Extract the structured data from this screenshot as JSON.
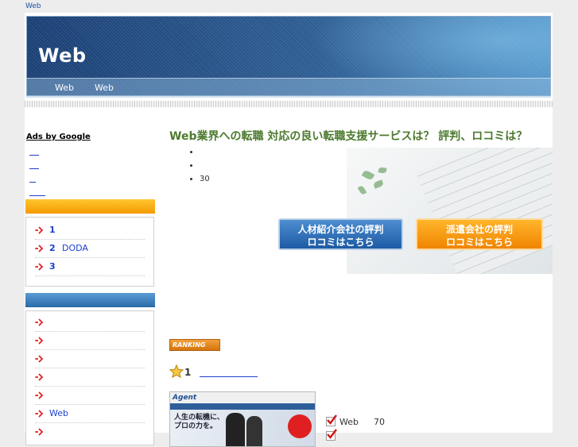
{
  "breadcrumb": "Web",
  "header": {
    "title": "Web",
    "nav": [
      "Web",
      "Web"
    ]
  },
  "sidebar": {
    "ads_title": "Ads by Google",
    "ranking_box": {
      "items": [
        {
          "num": "1",
          "label": ""
        },
        {
          "num": "2",
          "label": "DODA"
        },
        {
          "num": "3",
          "label": ""
        }
      ]
    },
    "category_box": {
      "items": [
        "",
        "",
        "",
        "",
        "",
        "Web",
        ""
      ]
    }
  },
  "main": {
    "headline": "Web業界への転職 対応の良い転職支援サービスは？ 評判、ロコミは？",
    "bullets": [
      "",
      "",
      "30"
    ],
    "banner_left": {
      "line1": "人材紹介会社の評判",
      "line2": "ロコミはこちら"
    },
    "banner_right": {
      "line1": "派遣会社の評判",
      "line2": "ロコミはこちら"
    },
    "ranking_badge": "RANKING",
    "rank1": {
      "num": "1"
    },
    "screenshot": {
      "logo": "Agent",
      "copy1": "人生の転機に、",
      "copy2": "プロの力を。"
    },
    "features": [
      {
        "text": "Web",
        "value": "70"
      },
      {
        "text": "",
        "value": ""
      }
    ]
  },
  "colors": {
    "headline": "#4c7a2e",
    "link": "#1a3fd0",
    "orange": "#f59b00",
    "blue": "#2a6aa8"
  }
}
